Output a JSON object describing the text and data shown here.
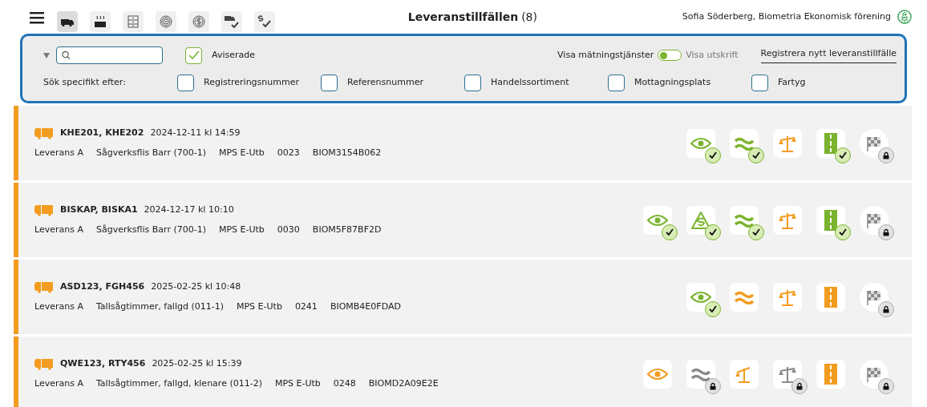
{
  "toolbar": {
    "tabs": [
      {
        "kind": "truck",
        "selected": true
      },
      {
        "kind": "heater",
        "selected": false
      },
      {
        "kind": "cabinet",
        "selected": false
      },
      {
        "kind": "rings",
        "selected": false
      },
      {
        "kind": "coin",
        "selected": false
      },
      {
        "kind": "truckcheck",
        "selected": false
      },
      {
        "kind": "scheck",
        "selected": false
      }
    ]
  },
  "title": {
    "text": "Leveranstillfällen",
    "count": "(8)"
  },
  "user": "Sofia Söderberg, Biometria Ekonomisk förening",
  "filter": {
    "expanded": false,
    "aviserade": {
      "label": "Aviserade",
      "checked": true
    },
    "toggle": {
      "left_label": "Visa mätningstjänster",
      "right_label": "Visa utskrift",
      "right_selected": false
    },
    "register_link": "Registrera nytt leveranstillfälle",
    "specific_label": "Sök specifikt efter:",
    "options": [
      {
        "label": "Registreringsnummer",
        "checked": false
      },
      {
        "label": "Referensnummer",
        "checked": false
      },
      {
        "label": "Handelssortiment",
        "checked": false
      },
      {
        "label": "Mottagningsplats",
        "checked": false
      },
      {
        "label": "Fartyg",
        "checked": false
      }
    ]
  },
  "rows": [
    {
      "title": "KHE201, KHE202",
      "date": "2024-12-11 kl 14:59",
      "details": [
        "Leverans A",
        "Sågverksflis Barr (700-1)",
        "MPS E-Utb",
        "0023",
        "BIOM3154B062"
      ],
      "statuses": [
        {
          "kind": "eye",
          "color": "#7ab32e",
          "verified": true,
          "locked": false
        },
        {
          "kind": "waves",
          "color": "#7ab32e",
          "verified": true,
          "locked": false
        },
        {
          "kind": "scale",
          "color": "#f39c1f",
          "verified": false,
          "locked": false
        },
        {
          "kind": "road",
          "color": "#7ab32e",
          "verified": true,
          "locked": false
        },
        {
          "kind": "flag",
          "color": "#8a8a8a",
          "verified": false,
          "locked": true
        }
      ]
    },
    {
      "title": "BISKAP, BISKA1",
      "date": "2024-12-17 kl 10:10",
      "details": [
        "Leverans A",
        "Sågverksflis Barr (700-1)",
        "MPS E-Utb",
        "0030",
        "BIOM5F87BF2D"
      ],
      "statuses": [
        {
          "kind": "eye",
          "color": "#7ab32e",
          "verified": true,
          "locked": false
        },
        {
          "kind": "sign",
          "color": "#7ab32e",
          "verified": true,
          "locked": false
        },
        {
          "kind": "waves",
          "color": "#7ab32e",
          "verified": true,
          "locked": false
        },
        {
          "kind": "scale",
          "color": "#f39c1f",
          "verified": false,
          "locked": false
        },
        {
          "kind": "road",
          "color": "#7ab32e",
          "verified": true,
          "locked": false
        },
        {
          "kind": "flag",
          "color": "#8a8a8a",
          "verified": false,
          "locked": true
        }
      ]
    },
    {
      "title": "ASD123, FGH456",
      "date": "2025-02-25 kl 10:48",
      "details": [
        "Leverans A",
        "Tallsågtimmer, fallgd (011-1)",
        "MPS E-Utb",
        "0241",
        "BIOMB4E0FDAD"
      ],
      "statuses": [
        {
          "kind": "eye",
          "color": "#7ab32e",
          "verified": true,
          "locked": false
        },
        {
          "kind": "waves",
          "color": "#f39c1f",
          "verified": false,
          "locked": false
        },
        {
          "kind": "scale",
          "color": "#f39c1f",
          "verified": false,
          "locked": false
        },
        {
          "kind": "road",
          "color": "#f39c1f",
          "verified": false,
          "locked": false
        },
        {
          "kind": "flag",
          "color": "#8a8a8a",
          "verified": false,
          "locked": true
        }
      ]
    },
    {
      "title": "QWE123, RTY456",
      "date": "2025-02-25 kl 15:39",
      "details": [
        "Leverans A",
        "Tallsågtimmer, fallgd, klenare (011-2)",
        "MPS E-Utb",
        "0248",
        "BIOMD2A09E2E"
      ],
      "statuses": [
        {
          "kind": "eye",
          "color": "#f39c1f",
          "verified": false,
          "locked": false
        },
        {
          "kind": "waves",
          "color": "#8a8a8a",
          "verified": false,
          "locked": true
        },
        {
          "kind": "half-scale",
          "color": "#f39c1f",
          "verified": false,
          "locked": false
        },
        {
          "kind": "scale",
          "color": "#8a8a8a",
          "verified": false,
          "locked": true
        },
        {
          "kind": "road",
          "color": "#f39c1f",
          "verified": false,
          "locked": false
        },
        {
          "kind": "flag",
          "color": "#8a8a8a",
          "verified": false,
          "locked": true
        }
      ]
    }
  ]
}
